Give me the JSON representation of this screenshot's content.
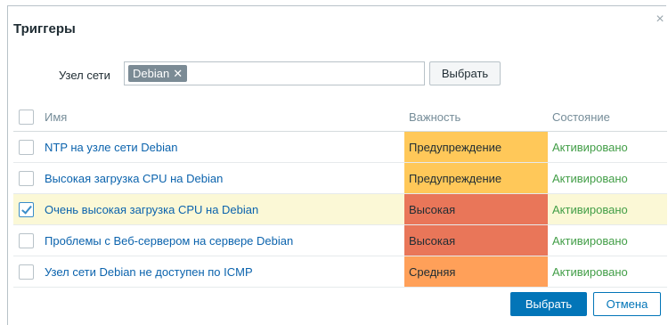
{
  "dialog": {
    "title": "Триггеры",
    "close_icon": "×"
  },
  "filter": {
    "host_label": "Узел сети",
    "tag": "Debian",
    "tag_remove": "✕",
    "select_label": "Выбрать"
  },
  "table": {
    "headers": {
      "name": "Имя",
      "severity": "Важность",
      "status": "Состояние"
    },
    "rows": [
      {
        "name": "NTP на узле сети Debian",
        "severity": "Предупреждение",
        "severity_color": "#ffc859",
        "status": "Активировано",
        "checked": false
      },
      {
        "name": "Высокая загрузка CPU на Debian",
        "severity": "Предупреждение",
        "severity_color": "#ffc859",
        "status": "Активировано",
        "checked": false
      },
      {
        "name": "Очень высокая загрузка CPU на Debian",
        "severity": "Высокая",
        "severity_color": "#e97659",
        "status": "Активировано",
        "checked": true
      },
      {
        "name": "Проблемы с Веб-сервером на сервере Debian",
        "severity": "Высокая",
        "severity_color": "#e97659",
        "status": "Активировано",
        "checked": false
      },
      {
        "name": "Узел сети Debian не доступен по ICMP",
        "severity": "Средняя",
        "severity_color": "#ffa059",
        "status": "Активировано",
        "checked": false
      }
    ]
  },
  "footer": {
    "select_label": "Выбрать",
    "cancel_label": "Отмена"
  },
  "colors": {
    "primary": "#0275b8",
    "link": "#0b63ad",
    "status_active": "#429e47",
    "selected_row": "#fbf8d6"
  }
}
